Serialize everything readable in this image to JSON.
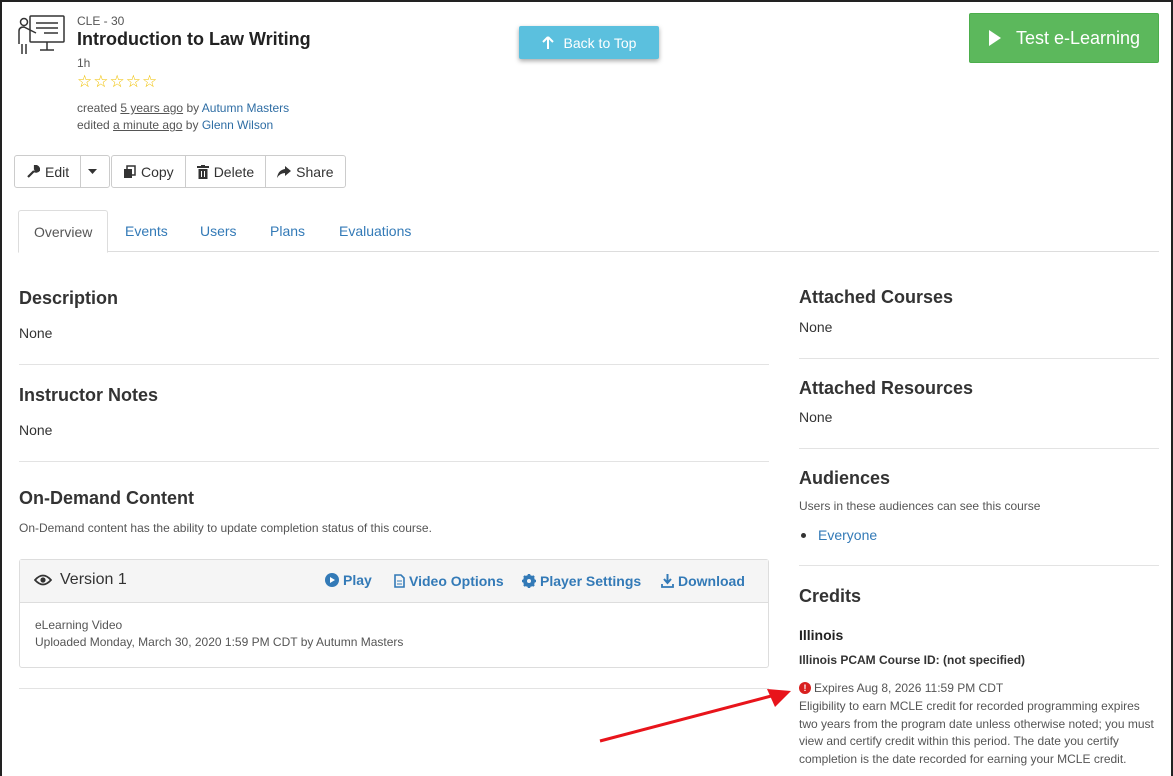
{
  "header": {
    "code": "CLE - 30",
    "title": "Introduction to Law Writing",
    "duration": "1h",
    "rating_stars": "☆☆☆☆☆",
    "created_prefix": "created",
    "created_when": "5 years ago",
    "created_by_word": "by",
    "created_by": "Autumn Masters",
    "edited_prefix": "edited",
    "edited_when": "a minute ago",
    "edited_by_word": "by",
    "edited_by": "Glenn Wilson"
  },
  "back_to_top": "Back to Top",
  "test_button": "Test e-Learning",
  "toolbar": {
    "edit": "Edit",
    "copy": "Copy",
    "delete": "Delete",
    "share": "Share"
  },
  "tabs": [
    "Overview",
    "Events",
    "Users",
    "Plans",
    "Evaluations"
  ],
  "left": {
    "description_title": "Description",
    "description_value": "None",
    "notes_title": "Instructor Notes",
    "notes_value": "None",
    "ondemand_title": "On-Demand Content",
    "ondemand_desc": "On-Demand content has the ability to update completion status of this course.",
    "version": {
      "title": "Version 1",
      "play": "Play",
      "video_options": "Video Options",
      "player_settings": "Player Settings",
      "download": "Download",
      "type": "eLearning Video",
      "uploaded": "Uploaded Monday, March 30, 2020 1:59 PM CDT by Autumn Masters"
    }
  },
  "right": {
    "attached_courses_title": "Attached Courses",
    "attached_courses_value": "None",
    "attached_resources_title": "Attached Resources",
    "attached_resources_value": "None",
    "audiences_title": "Audiences",
    "audiences_desc": "Users in these audiences can see this course",
    "audiences": [
      "Everyone"
    ],
    "credits_title": "Credits",
    "credit_state": "Illinois",
    "credit_course_id": "Illinois PCAM Course ID: (not specified)",
    "expires": "Expires Aug 8, 2026 11:59 PM CDT",
    "eligibility": "Eligibility to earn MCLE credit for recorded programming expires two years from the program date unless otherwise noted; you must view and certify credit within this period. The date you certify completion is the date recorded for earning your MCLE credit."
  },
  "colors": {
    "primary_link": "#337ab7",
    "info_button": "#5bc0de",
    "success_button": "#5cb85c",
    "warning": "#d9201f",
    "annotation_arrow": "#e8141b"
  }
}
